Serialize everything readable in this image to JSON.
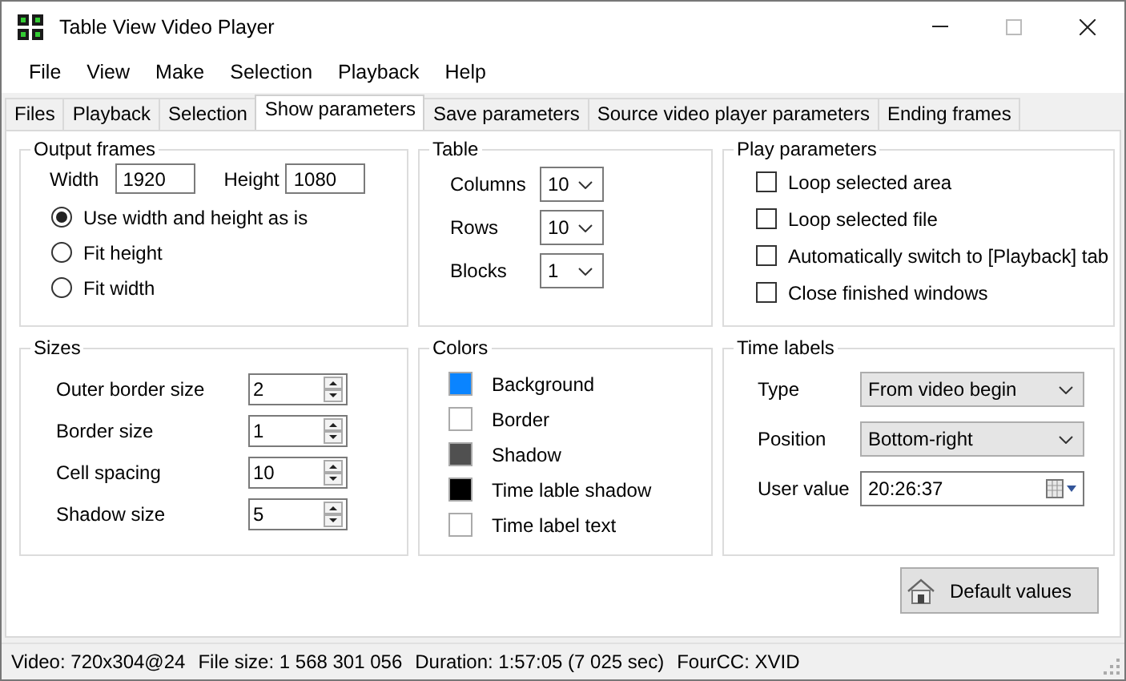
{
  "window": {
    "title": "Table View Video Player"
  },
  "menu": [
    "File",
    "View",
    "Make",
    "Selection",
    "Playback",
    "Help"
  ],
  "tabs": [
    {
      "label": "Files",
      "selected": false
    },
    {
      "label": "Playback",
      "selected": false
    },
    {
      "label": "Selection",
      "selected": false
    },
    {
      "label": "Show parameters",
      "selected": true
    },
    {
      "label": "Save parameters",
      "selected": false
    },
    {
      "label": "Source video player parameters",
      "selected": false
    },
    {
      "label": "Ending frames",
      "selected": false
    }
  ],
  "output_frames": {
    "title": "Output frames",
    "width_label": "Width",
    "width_value": "1920",
    "height_label": "Height",
    "height_value": "1080",
    "radios": [
      {
        "label": "Use width and height as is",
        "selected": true
      },
      {
        "label": "Fit height",
        "selected": false
      },
      {
        "label": "Fit width",
        "selected": false
      }
    ]
  },
  "table": {
    "title": "Table",
    "fields": [
      {
        "label": "Columns",
        "value": "10"
      },
      {
        "label": "Rows",
        "value": "10"
      },
      {
        "label": "Blocks",
        "value": "1"
      }
    ]
  },
  "play_parameters": {
    "title": "Play parameters",
    "checkboxes": [
      {
        "label": "Loop selected area",
        "checked": false
      },
      {
        "label": "Loop selected file",
        "checked": false
      },
      {
        "label": "Automatically switch to [Playback] tab",
        "checked": false
      },
      {
        "label": "Close finished windows",
        "checked": false
      }
    ]
  },
  "sizes": {
    "title": "Sizes",
    "fields": [
      {
        "label": "Outer border size",
        "value": "2"
      },
      {
        "label": "Border size",
        "value": "1"
      },
      {
        "label": "Cell spacing",
        "value": "10"
      },
      {
        "label": "Shadow size",
        "value": "5"
      }
    ]
  },
  "colors": {
    "title": "Colors",
    "items": [
      {
        "label": "Background",
        "color": "#0a84ff"
      },
      {
        "label": "Border",
        "color": "#ffffff"
      },
      {
        "label": "Shadow",
        "color": "#505050"
      },
      {
        "label": "Time lable shadow",
        "color": "#000000"
      },
      {
        "label": "Time label text",
        "color": "#ffffff"
      }
    ]
  },
  "time_labels": {
    "title": "Time labels",
    "fields": [
      {
        "kind": "dropdown",
        "label": "Type",
        "value": "From video begin"
      },
      {
        "kind": "dropdown",
        "label": "Position",
        "value": "Bottom-right"
      },
      {
        "kind": "time",
        "label": "User value",
        "value": "20:26:37"
      }
    ]
  },
  "default_button": {
    "label": "Default values"
  },
  "status_bar": [
    "Video: 720x304@24",
    "File size: 1 568 301 056",
    "Duration: 1:57:05 (7 025 sec)",
    "FourCC: XVID"
  ]
}
